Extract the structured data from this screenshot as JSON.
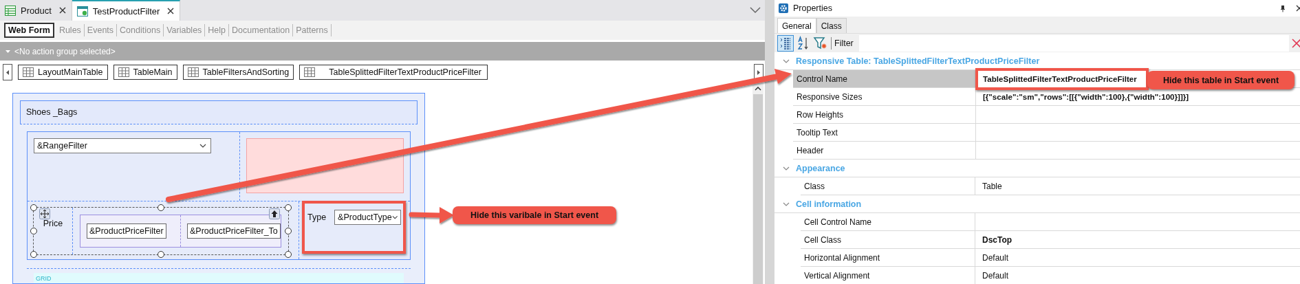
{
  "document_tabs": [
    {
      "label": "Product",
      "selected": false
    },
    {
      "label": "TestProductFilter",
      "selected": true
    }
  ],
  "editor_tabs": [
    {
      "label": "Web Form",
      "selected": true
    },
    {
      "label": "Rules",
      "selected": false
    },
    {
      "label": "Events",
      "selected": false
    },
    {
      "label": "Conditions",
      "selected": false
    },
    {
      "label": "Variables",
      "selected": false
    },
    {
      "label": "Help",
      "selected": false
    },
    {
      "label": "Documentation",
      "selected": false
    },
    {
      "label": "Patterns",
      "selected": false
    }
  ],
  "action_bar": {
    "text": "<No action group selected>"
  },
  "breadcrumb": [
    "LayoutMainTable",
    "TableMain",
    "TableFiltersAndSorting",
    "TableSplittedFilterTextProductPriceFilter"
  ],
  "form": {
    "title": "Shoes _Bags",
    "range_filter": "&RangeFilter",
    "price_label": "Price",
    "price_from": "&ProductPriceFilter",
    "price_to": "&ProductPriceFilter_To",
    "type_label": "Type",
    "type_field": "&ProductType",
    "grid_label": "GRID"
  },
  "properties": {
    "title": "Properties",
    "tabs": [
      {
        "label": "General",
        "selected": true
      },
      {
        "label": "Class",
        "selected": false
      }
    ],
    "filter_label": "Filter",
    "sections": [
      {
        "title": "Responsive Table: TableSplittedFilterTextProductPriceFilter",
        "expanded": true,
        "rows": [
          {
            "name": "Control Name",
            "value": "TableSplittedFilterTextProductPriceFilter",
            "bold": true,
            "selected": true
          },
          {
            "name": "Responsive Sizes",
            "value": "[{\"scale\":\"sm\",\"rows\":[[{\"width\":100},{\"width\":100}]]}]",
            "bold": true,
            "selected": false
          },
          {
            "name": "Row Heights",
            "selected": false
          },
          {
            "name": "Tooltip Text",
            "selected": false
          },
          {
            "name": "Header",
            "selected": false
          }
        ]
      },
      {
        "title": "Appearance",
        "expanded": true,
        "rows": [
          {
            "name": "Class",
            "value": "Table",
            "bold": false,
            "selected": false
          }
        ]
      },
      {
        "title": "Cell information",
        "expanded": true,
        "rows": [
          {
            "name": "Cell Control Name",
            "selected": false
          },
          {
            "name": "Cell Class",
            "value": "DscTop",
            "bold": true,
            "selected": false
          },
          {
            "name": "Horizontal Alignment",
            "value": "Default",
            "bold": false,
            "selected": false
          },
          {
            "name": "Vertical Alignment",
            "value": "Default",
            "bold": false,
            "selected": false
          }
        ]
      }
    ]
  },
  "annotations": [
    {
      "text": "Hide this varibale in Start event"
    },
    {
      "text": "Hide this table in Start event"
    }
  ]
}
